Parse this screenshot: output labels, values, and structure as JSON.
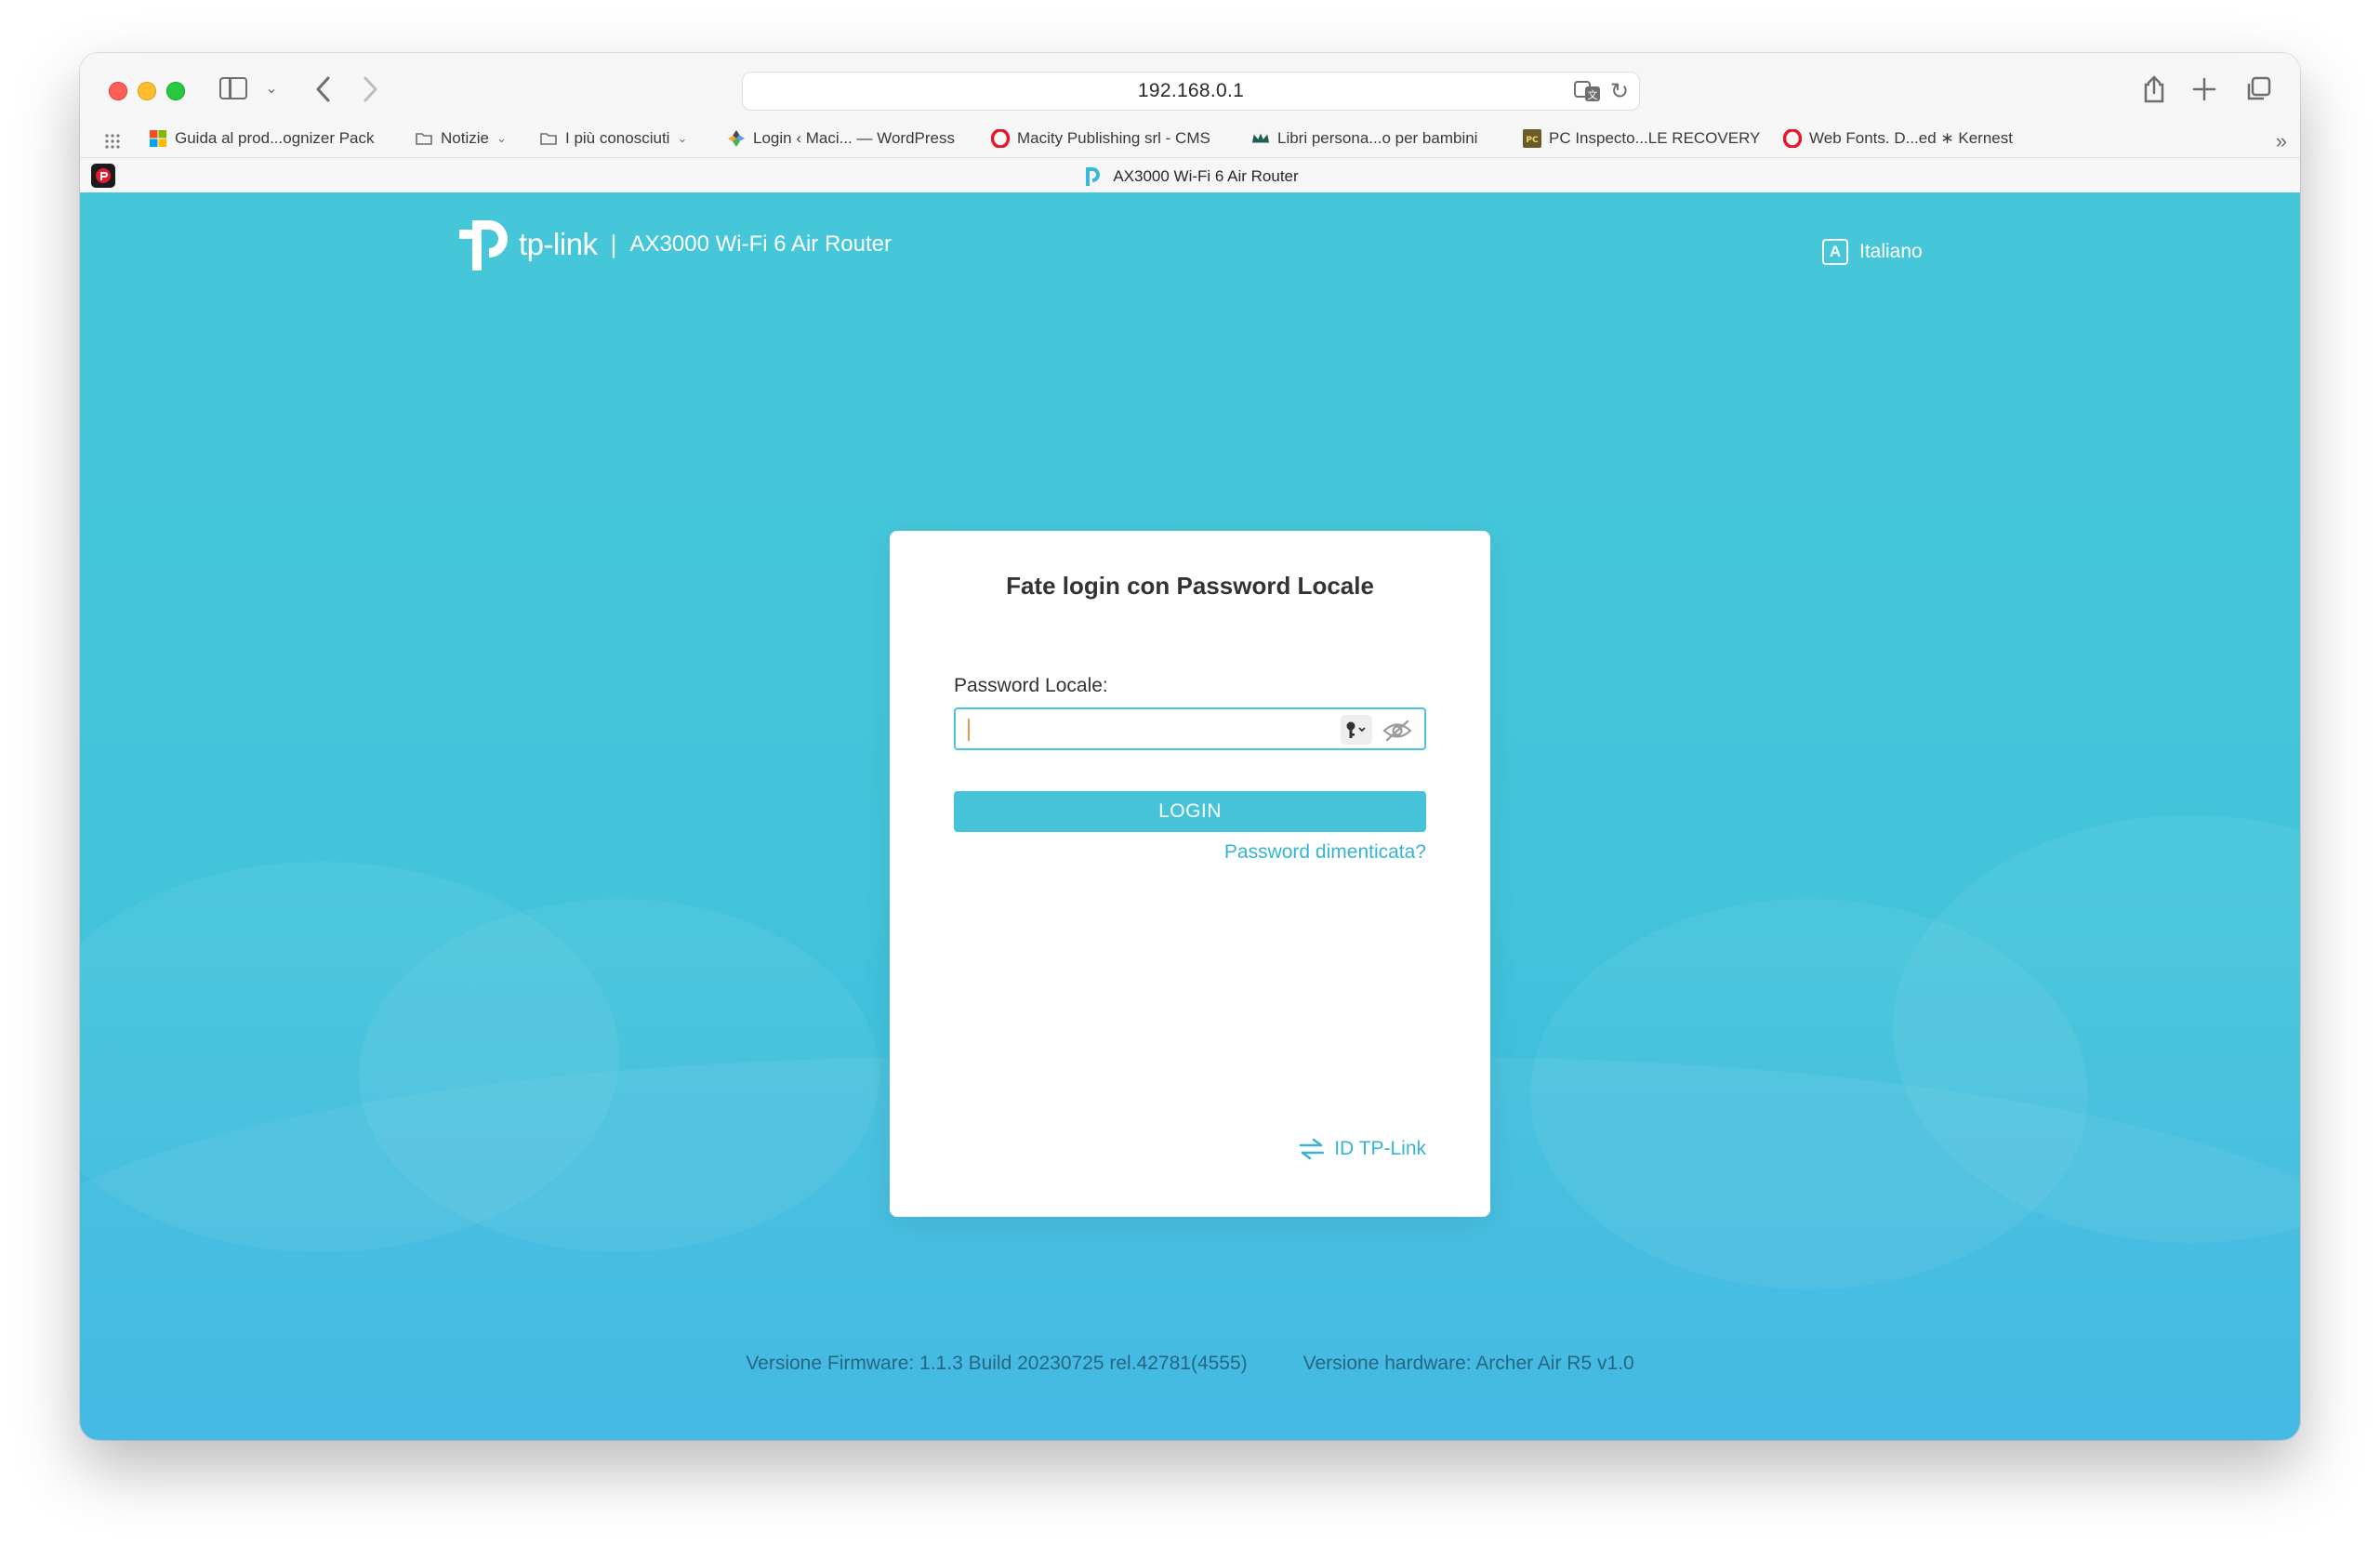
{
  "browser": {
    "url": "192.168.0.1",
    "bookmarks": [
      {
        "label": "Guida al prod...ognizer Pack",
        "icon": "microsoft-icon"
      },
      {
        "label": "Notizie",
        "icon": "folder-icon"
      },
      {
        "label": "I più conosciuti",
        "icon": "folder-icon"
      },
      {
        "label": "Login ‹ Maci... — WordPress",
        "icon": "site-icon"
      },
      {
        "label": "Macity Publishing srl - CMS",
        "icon": "opera-icon"
      },
      {
        "label": "Libri persona...o per bambini",
        "icon": "crown-icon"
      },
      {
        "label": "PC Inspecto...LE RECOVERY",
        "icon": "pc-icon"
      },
      {
        "label": "Web Fonts. D...ed ∗ Kernest",
        "icon": "opera-icon"
      }
    ],
    "tab_title": "AX3000 Wi-Fi 6 Air Router"
  },
  "header": {
    "brand": "tp-link",
    "separator": "|",
    "model": "AX3000 Wi-Fi 6 Air Router",
    "language": "Italiano",
    "language_glyph": "A"
  },
  "login": {
    "title": "Fate login con Password Locale",
    "password_label": "Password Locale:",
    "password_value": "",
    "button_label": "LOGIN",
    "forgot_label": "Password dimenticata?",
    "id_link_label": "ID TP-Link"
  },
  "footer": {
    "firmware": "Versione Firmware: 1.1.3 Build 20230725 rel.42781(4555)",
    "hardware": "Versione hardware: Archer Air R5 v1.0"
  },
  "colors": {
    "accent": "#47c3d9",
    "link": "#37b4d1",
    "background_top": "#46c7d9",
    "background_bottom": "#3ab6e3"
  }
}
